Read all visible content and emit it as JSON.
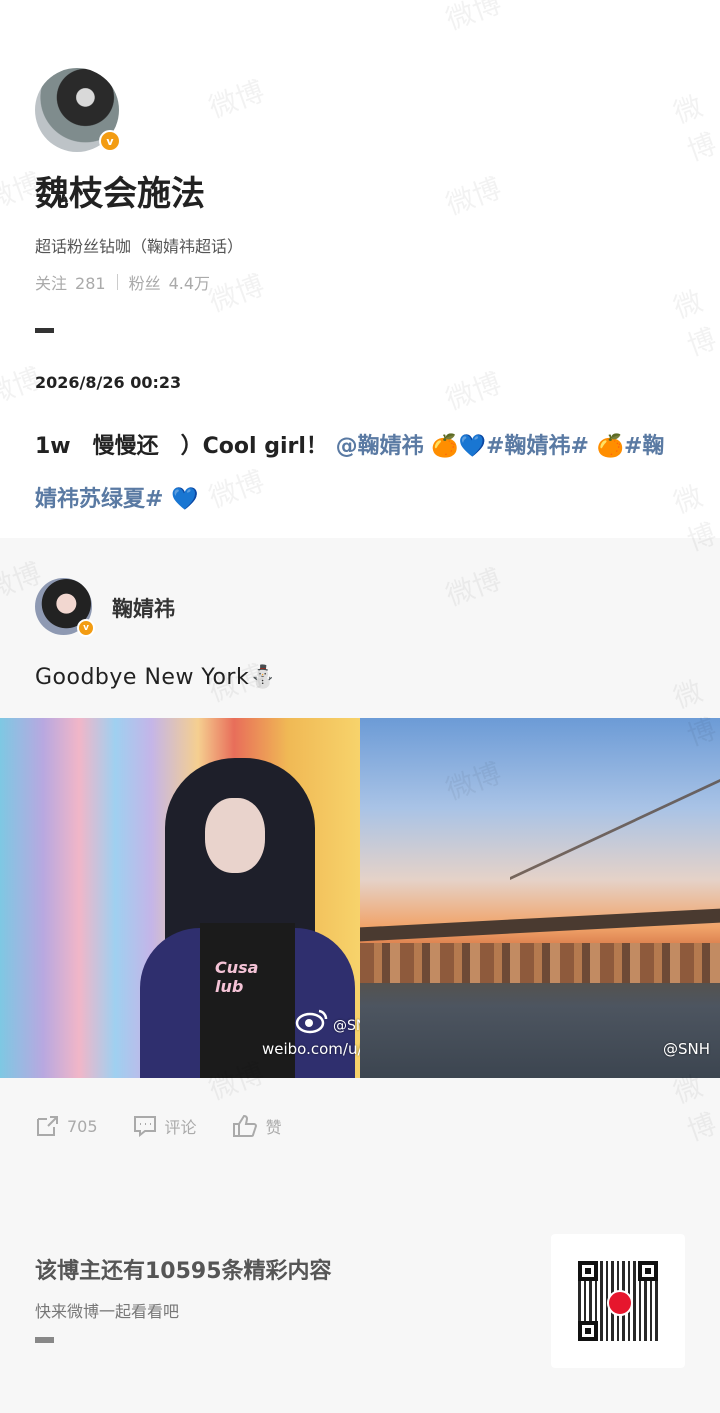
{
  "profile": {
    "name": "魏枝会施法",
    "title": "超话粉丝钻咖（鞠婧祎超话）",
    "following_label": "关注",
    "following_count": "281",
    "followers_label": "粉丝",
    "followers_count": "4.4万",
    "verified_mark": "v"
  },
  "post": {
    "date": "2026/8/26 00:23",
    "text_prefix": "1w　慢慢还　）Cool girl！",
    "mention": "@鞠婧祎",
    "emoji1": "🍊💙",
    "tag1": "#鞠婧祎#",
    "emoji2": "🍊",
    "tag2": "#鞠婧祎苏绿夏#",
    "emoji3": "💙"
  },
  "retweet": {
    "author": "鞠婧祎",
    "verified_mark": "v",
    "text": "Goodbye New York⛄",
    "photo_left_credit_line1": "@SN",
    "photo_left_credit_line2": "weibo.com/u/",
    "photo_left_shirt_print": "Cusa lub",
    "photo_right_credit": "@SNH"
  },
  "actions": {
    "repost_count": "705",
    "comment_label": "评论",
    "like_label": "赞"
  },
  "footer": {
    "title": "该博主还有10595条精彩内容",
    "subtitle": "快来微博一起看看吧"
  },
  "watermark_text": "微博",
  "colors": {
    "link": "#5a7aa3",
    "verified_badge": "#f39c12",
    "section_bg": "#f7f7f7"
  }
}
